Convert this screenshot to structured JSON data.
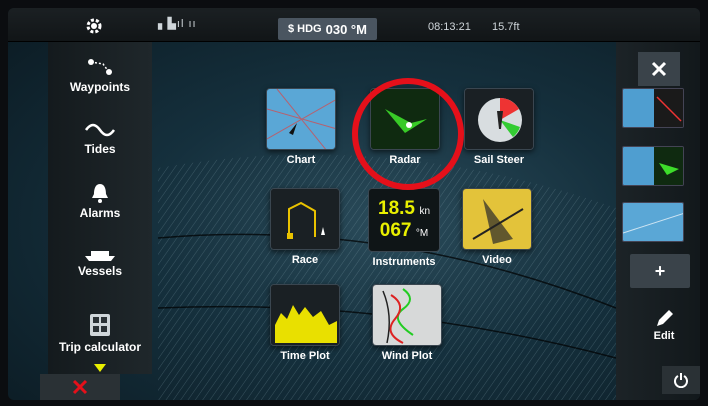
{
  "status": {
    "signal_text": "&#x2597;&#x259C;ıl ıı",
    "heading_prefix": "$ HDG",
    "heading_value": "030 °M",
    "time": "08:13:21",
    "depth": "15.7ft"
  },
  "sidebar": {
    "items": [
      {
        "label": "Waypoints",
        "icon": "waypoints-icon"
      },
      {
        "label": "Tides",
        "icon": "tides-icon"
      },
      {
        "label": "Alarms",
        "icon": "bell-icon"
      },
      {
        "label": "Vessels",
        "icon": "vessels-icon"
      },
      {
        "label": "Trip calculator",
        "icon": "calculator-icon"
      }
    ]
  },
  "tiles": {
    "chart": "Chart",
    "radar": "Radar",
    "sail_steer": "Sail Steer",
    "race": "Race",
    "instruments": "Instruments",
    "instruments_speed": "18.5",
    "instruments_speed_unit": "kn",
    "instruments_heading": "067",
    "instruments_heading_unit": "°M",
    "video": "Video",
    "time_plot": "Time Plot",
    "wind_plot": "Wind Plot"
  },
  "right_panel": {
    "add_label": "+",
    "edit_label": "Edit"
  },
  "colors": {
    "accent_yellow": "#e9f000",
    "highlight_red": "#e5101a",
    "radar_green": "#3ddc2a"
  }
}
